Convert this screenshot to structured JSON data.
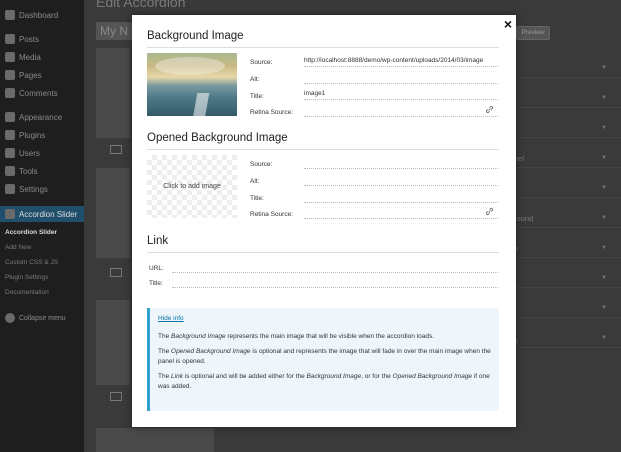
{
  "sidebar": {
    "items": [
      {
        "label": "Dashboard",
        "icon": "dashboard-icon"
      },
      {
        "label": "Posts",
        "icon": "pin-icon"
      },
      {
        "label": "Media",
        "icon": "media-icon"
      },
      {
        "label": "Pages",
        "icon": "pages-icon"
      },
      {
        "label": "Comments",
        "icon": "comments-icon"
      },
      {
        "label": "Appearance",
        "icon": "appearance-icon"
      },
      {
        "label": "Plugins",
        "icon": "plugins-icon"
      },
      {
        "label": "Users",
        "icon": "users-icon"
      },
      {
        "label": "Tools",
        "icon": "tools-icon"
      },
      {
        "label": "Settings",
        "icon": "settings-icon"
      },
      {
        "label": "Accordion Slider",
        "icon": "accordion-icon",
        "active": true
      }
    ],
    "submenu": [
      "Accordion Slider",
      "Add New",
      "Custom CSS & JS",
      "Plugin Settings",
      "Documentation"
    ],
    "collapse_label": "Collapse menu"
  },
  "main": {
    "heading": "Edit Accordion",
    "title_value": "My N",
    "preview_label": "Preview",
    "side_fragments": [
      "nel",
      "round",
      "e",
      "s"
    ]
  },
  "modal": {
    "close_label": "×",
    "background": {
      "title": "Background Image",
      "source_label": "Source:",
      "source_value": "http://localhost:8888/demo/wp-content/uploads/2014/03/image",
      "alt_label": "Alt:",
      "alt_value": "",
      "title_label": "Title:",
      "title_value": "image1",
      "retina_label": "Retina Source:",
      "retina_value": ""
    },
    "opened": {
      "title": "Opened Background Image",
      "placeholder": "Click to add image",
      "source_label": "Source:",
      "alt_label": "Alt:",
      "title_label": "Title:",
      "retina_label": "Retina Source:"
    },
    "link": {
      "title": "Link",
      "url_label": "URL:",
      "title_label": "Title:"
    },
    "info": {
      "hide_link": "Hide info",
      "p1_a": "The ",
      "p1_em": "Background Image",
      "p1_b": " represents the main image that will be visible when the accordion loads.",
      "p2_a": "The ",
      "p2_em": "Opened Background Image",
      "p2_b": " is optional and represents the image that will fade in over the main image when the panel is opened.",
      "p3_a": "The ",
      "p3_em1": "Link",
      "p3_b": " is optional and will be added either for the ",
      "p3_em2": "Background Image",
      "p3_c": ", or for the ",
      "p3_em3": "Opened Background Image",
      "p3_d": " if one was added."
    }
  },
  "colors": {
    "accent": "#2ea2cc",
    "link": "#0074a2",
    "info_bg": "#eef6fb",
    "active_menu": "#1f4f6a"
  }
}
